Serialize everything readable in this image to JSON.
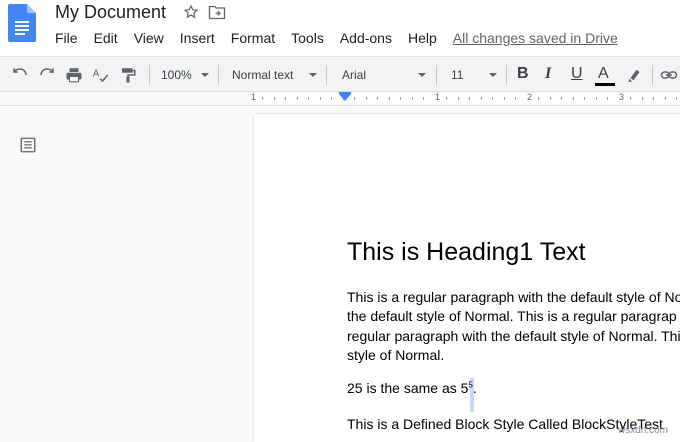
{
  "app": {
    "title": "My Document",
    "menu": [
      "File",
      "Edit",
      "View",
      "Insert",
      "Format",
      "Tools",
      "Add-ons",
      "Help"
    ],
    "save_status": "All changes saved in Drive"
  },
  "toolbar": {
    "zoom": "100%",
    "style": "Normal text",
    "font": "Arial",
    "font_size": "11",
    "bold": "B",
    "italic": "I",
    "underline": "U",
    "text_color_label": "A",
    "icons": [
      "undo-icon",
      "redo-icon",
      "print-icon",
      "spellcheck-icon",
      "paint-format-icon",
      "highlighter-icon",
      "link-icon"
    ]
  },
  "ruler": {
    "numbers": [
      "1",
      "1",
      "2",
      "3"
    ]
  },
  "document": {
    "heading": "This is Heading1 Text",
    "paragraph_lines": [
      "This is a regular paragraph with the default style of No",
      "the default style of Normal. This is a regular paragrap",
      "regular paragraph with the default style of Normal. Thi",
      "style of Normal."
    ],
    "formula_text": "25 is the same as 5",
    "formula_sup": "5",
    "formula_end": ".",
    "block_style_line": "This is a Defined Block Style Called BlockStyleTest"
  },
  "watermark": "wsxdn.com"
}
